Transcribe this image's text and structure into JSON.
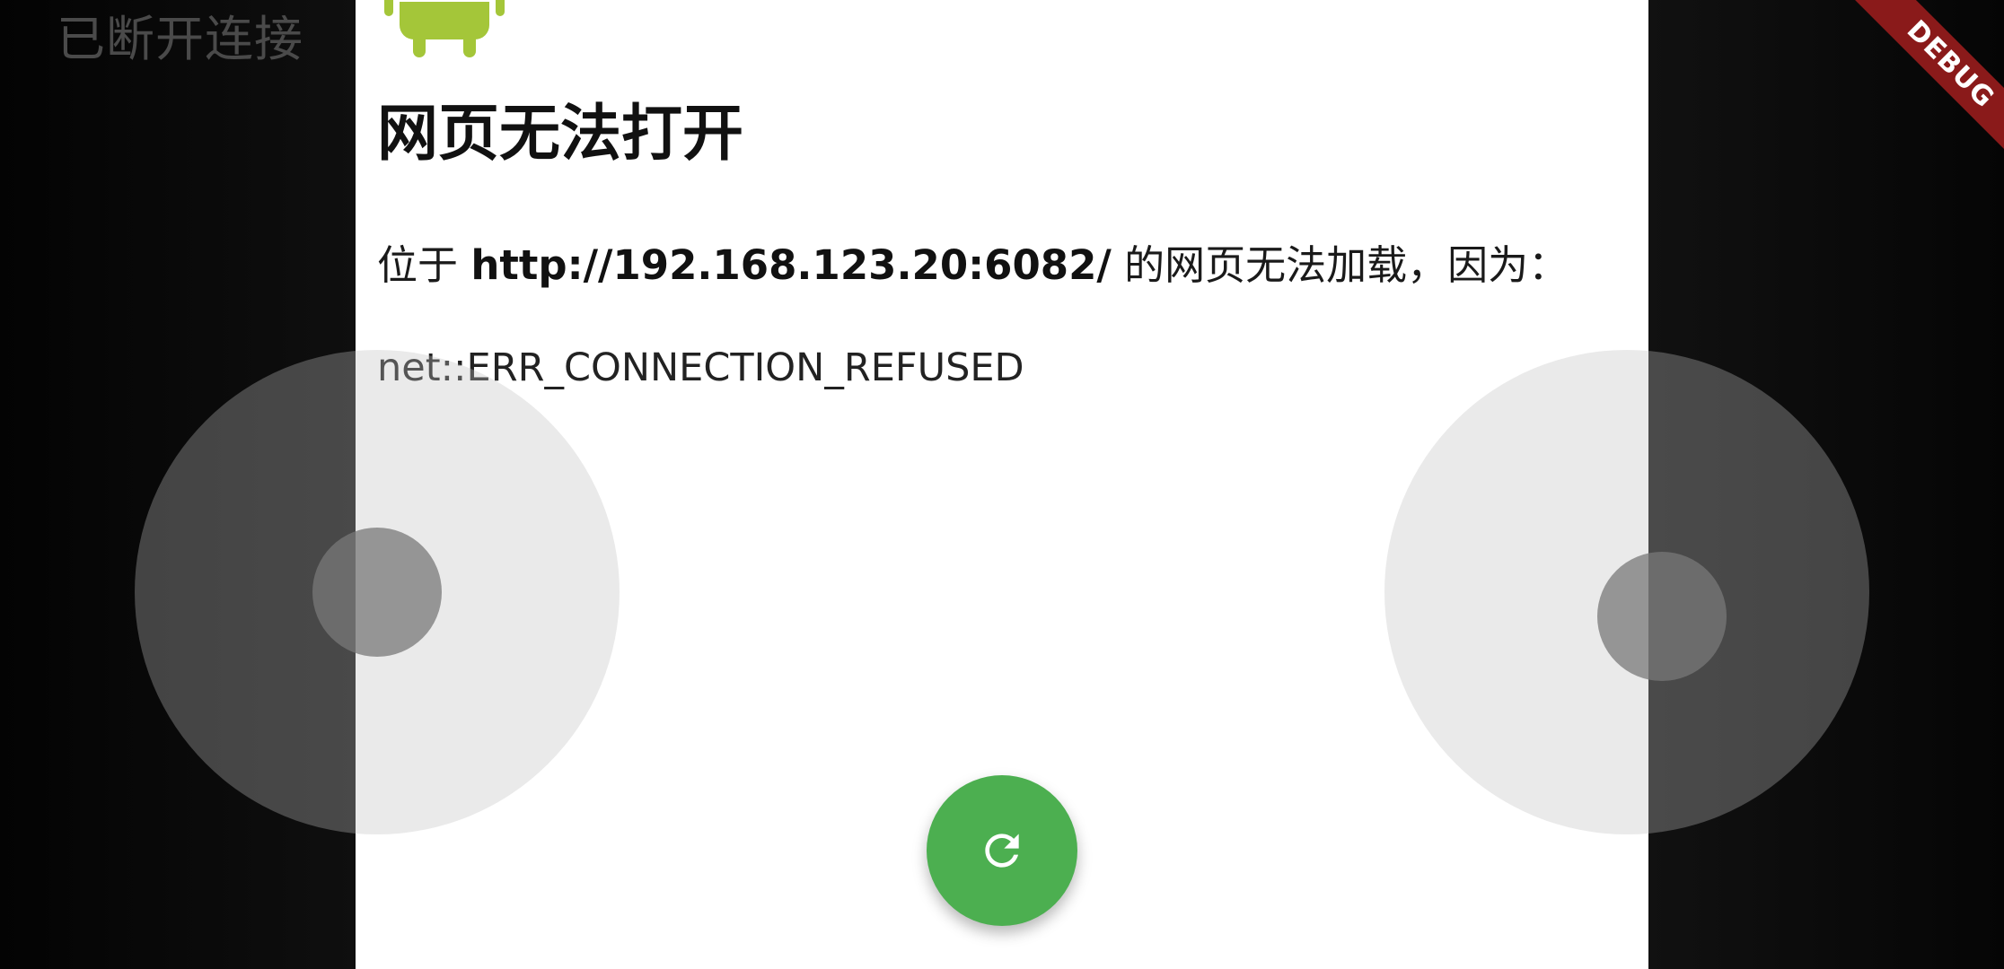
{
  "status": {
    "text": "已断开连接"
  },
  "error_page": {
    "title": "网页无法打开",
    "desc_prefix": "位于",
    "url": "http://192.168.123.20:6082/",
    "desc_suffix": "的网页无法加载，因为：",
    "error_code": "net::ERR_CONNECTION_REFUSED",
    "logo_icon": "android-robot-icon",
    "logo_color": "#a4c639"
  },
  "controls": {
    "left_joystick": "joystick",
    "right_joystick": "joystick",
    "refresh_icon": "refresh-icon",
    "refresh_color": "#4caf50"
  },
  "debug_banner": {
    "label": "DEBUG",
    "color": "#8a1a1a"
  }
}
